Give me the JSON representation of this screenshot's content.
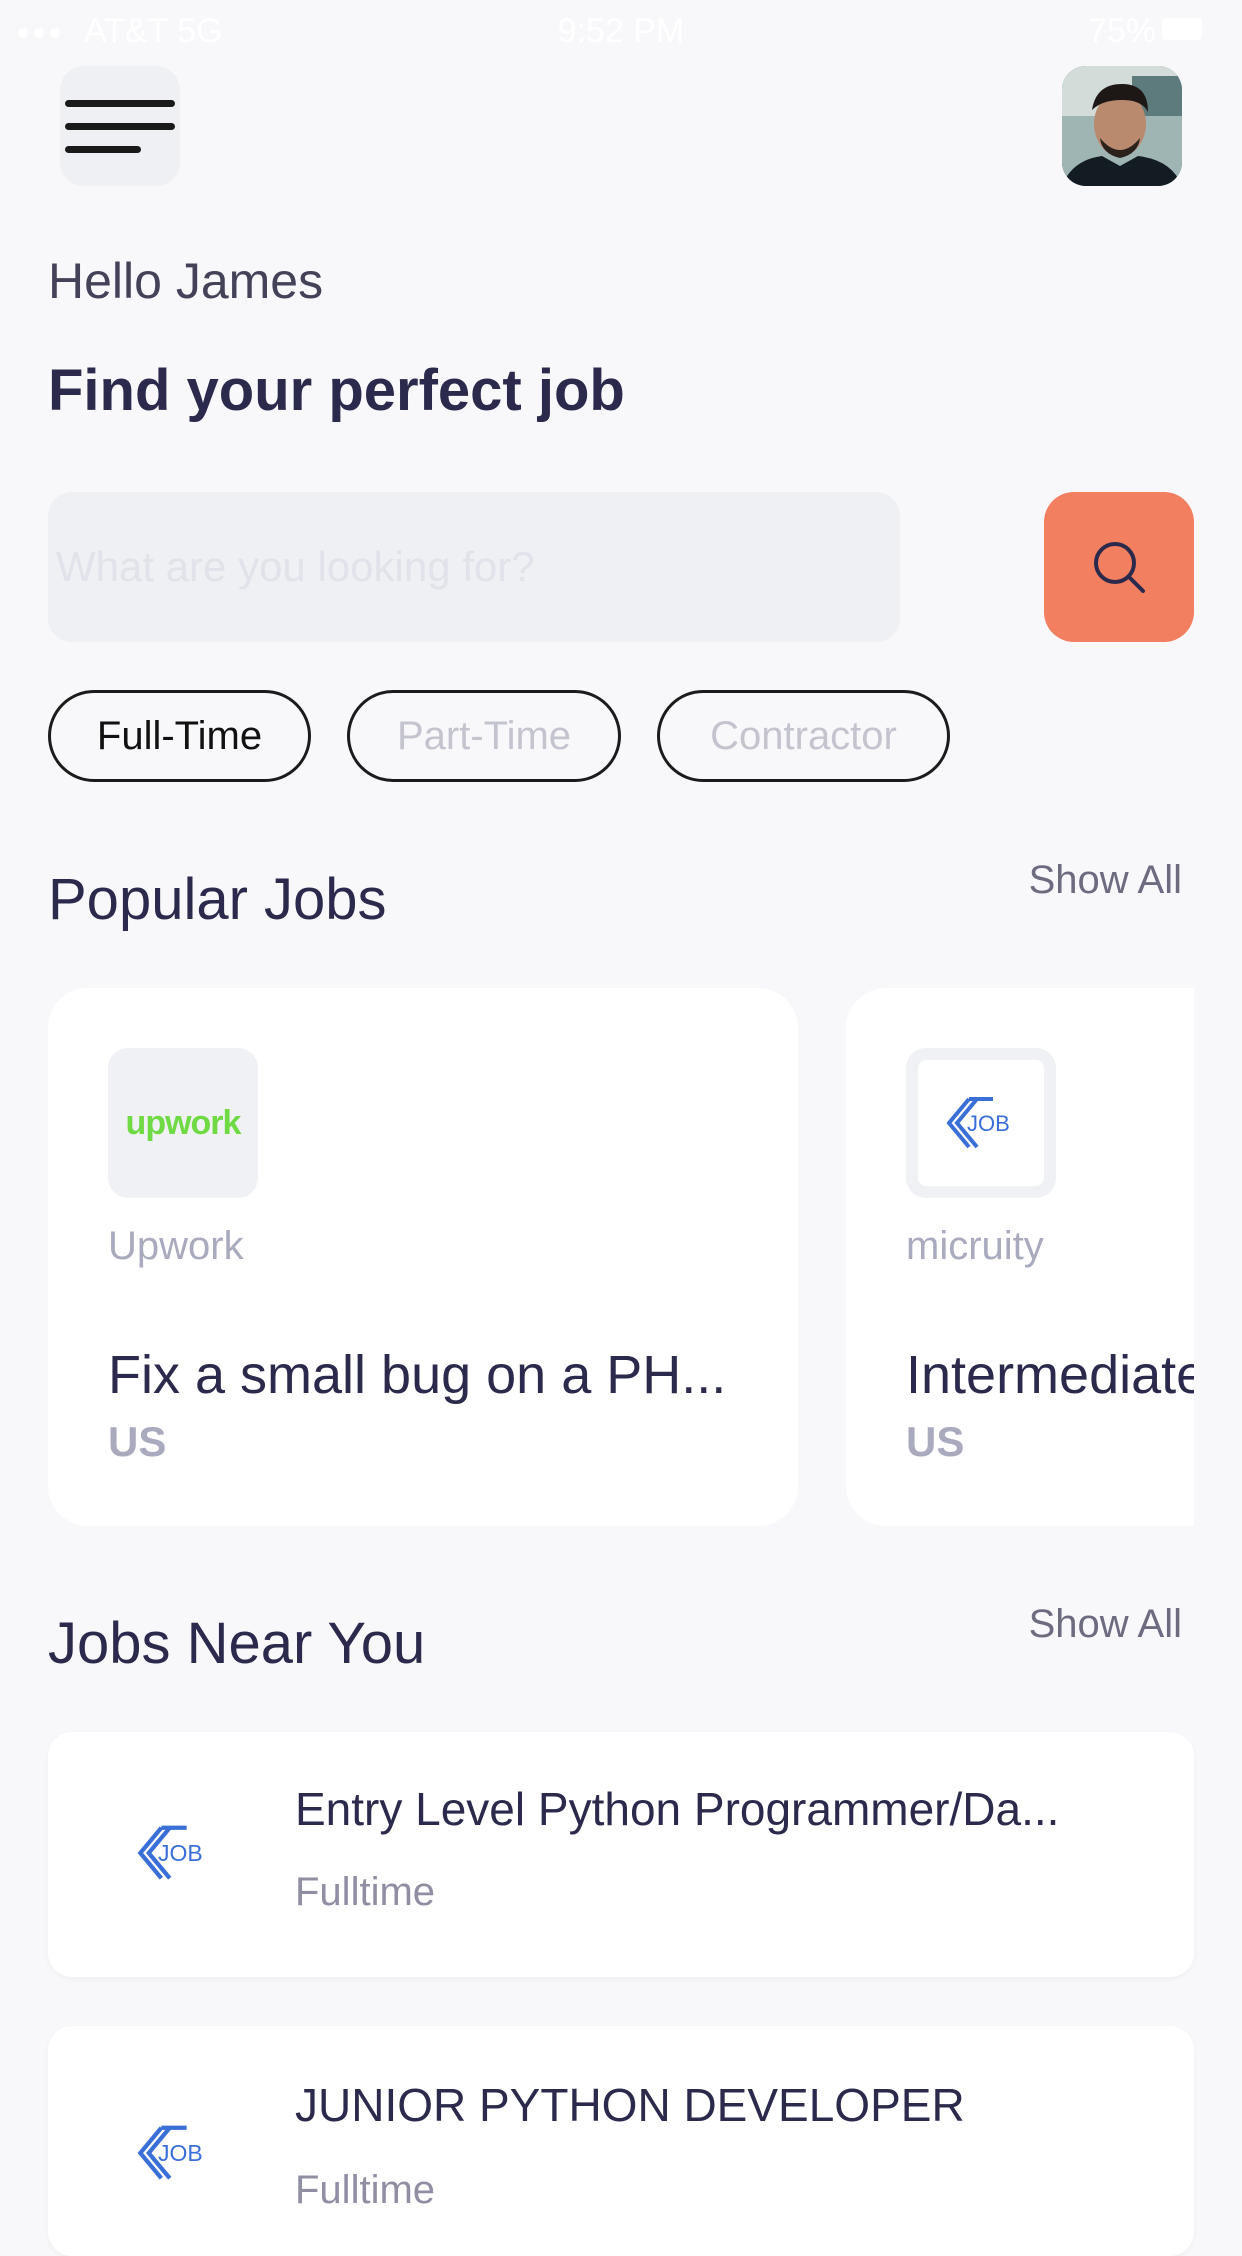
{
  "status_bar": {
    "carrier": "AT&T  5G",
    "time": "9:52 PM",
    "battery": "75%"
  },
  "header": {
    "menu_icon": "hamburger-menu-icon",
    "avatar_icon": "user-avatar"
  },
  "greeting": "Hello James",
  "headline": "Find your perfect job",
  "search": {
    "placeholder": "What are you looking for?",
    "value": "",
    "icon": "search-icon"
  },
  "job_types": [
    {
      "label": "Full-Time",
      "selected": true
    },
    {
      "label": "Part-Time",
      "selected": false
    },
    {
      "label": "Contractor",
      "selected": false
    }
  ],
  "popular_jobs": {
    "title": "Popular Jobs",
    "show_all": "Show All",
    "items": [
      {
        "company": "Upwork",
        "logo_text": "upwork",
        "title": "Fix a small bug on a PH...",
        "location": "US"
      },
      {
        "company": "micruity",
        "logo_text": "JOB",
        "title": "Intermediate",
        "location": "US"
      }
    ]
  },
  "jobs_near_you": {
    "title": "Jobs Near You",
    "show_all": "Show All",
    "items": [
      {
        "logo_text": "JOB",
        "title": "Entry Level Python Programmer/Da...",
        "type": "Fulltime"
      },
      {
        "logo_text": "JOB",
        "title": "JUNIOR PYTHON DEVELOPER",
        "type": "Fulltime"
      }
    ]
  },
  "colors": {
    "accent": "#f27f5f",
    "text_dark": "#2b2a4c",
    "muted": "#a9aabd",
    "background": "#f8f8fb",
    "upwork_green": "#6fda44",
    "job_blue": "#3a6fd8"
  }
}
